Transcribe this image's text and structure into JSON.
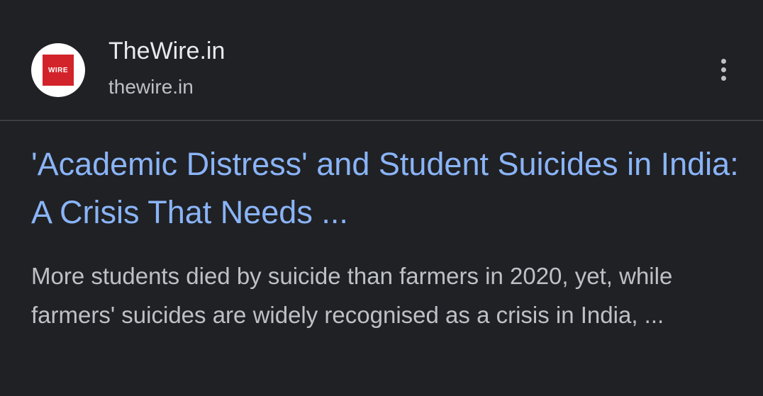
{
  "result": {
    "favicon_text": "WIRE",
    "site_name": "TheWire.in",
    "site_url": "thewire.in",
    "more_icon": "more-vert-icon",
    "title": "'Academic Distress' and Student Suicides in India: A Crisis That Needs ...",
    "snippet": "More students died by suicide than farmers in 2020, yet, while farmers' suicides are widely recognised as a crisis in India, ..."
  },
  "colors": {
    "background": "#202124",
    "title_link": "#8ab4f8",
    "snippet_text": "#bdc1c6",
    "site_name_text": "#e8eaed",
    "favicon_red": "#d2232a"
  }
}
